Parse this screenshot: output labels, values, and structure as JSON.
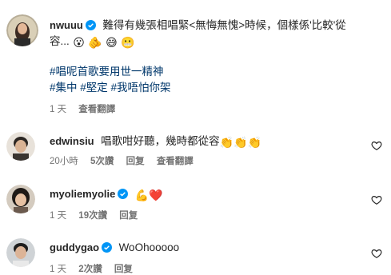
{
  "post": {
    "username": "nwuuu",
    "caption_line1": "難得有幾張相唱緊<無悔無愧>時候，個樣係'比較'從",
    "caption_line2": "容...",
    "caption_emojis": [
      "😮",
      "🫵",
      "😅",
      "😬"
    ],
    "hashtag_line1": "#唱呢首歌要用世一精神",
    "hashtag_line2": "#集中 #堅定 #我唔怕你架",
    "time": "1 天",
    "translate": "查看翻譯"
  },
  "comments": [
    {
      "username": "edwinsiu",
      "text": "唱歌咁好聽，幾時都從容",
      "emojis": [
        "👏",
        "👏",
        "👏"
      ],
      "time": "20小時",
      "likes": "5次讚",
      "reply": "回复",
      "translate": "查看翻譯",
      "verified": false
    },
    {
      "username": "myoliemyolie",
      "text": "",
      "emojis": [
        "💪",
        "❤️"
      ],
      "time": "1 天",
      "likes": "19次讚",
      "reply": "回复",
      "verified": true
    },
    {
      "username": "guddygao",
      "text": "WoOhooooo",
      "emojis": [],
      "time": "1 天",
      "likes": "2次讚",
      "reply": "回复",
      "verified": true
    }
  ],
  "colors": {
    "verified_blue": "#0095f6",
    "hashtag_blue": "#00376b",
    "meta_gray": "#737373",
    "heart_red": "#ed4956"
  },
  "icons": {
    "verified": "verified-badge-icon",
    "heart": "heart-outline-icon"
  }
}
